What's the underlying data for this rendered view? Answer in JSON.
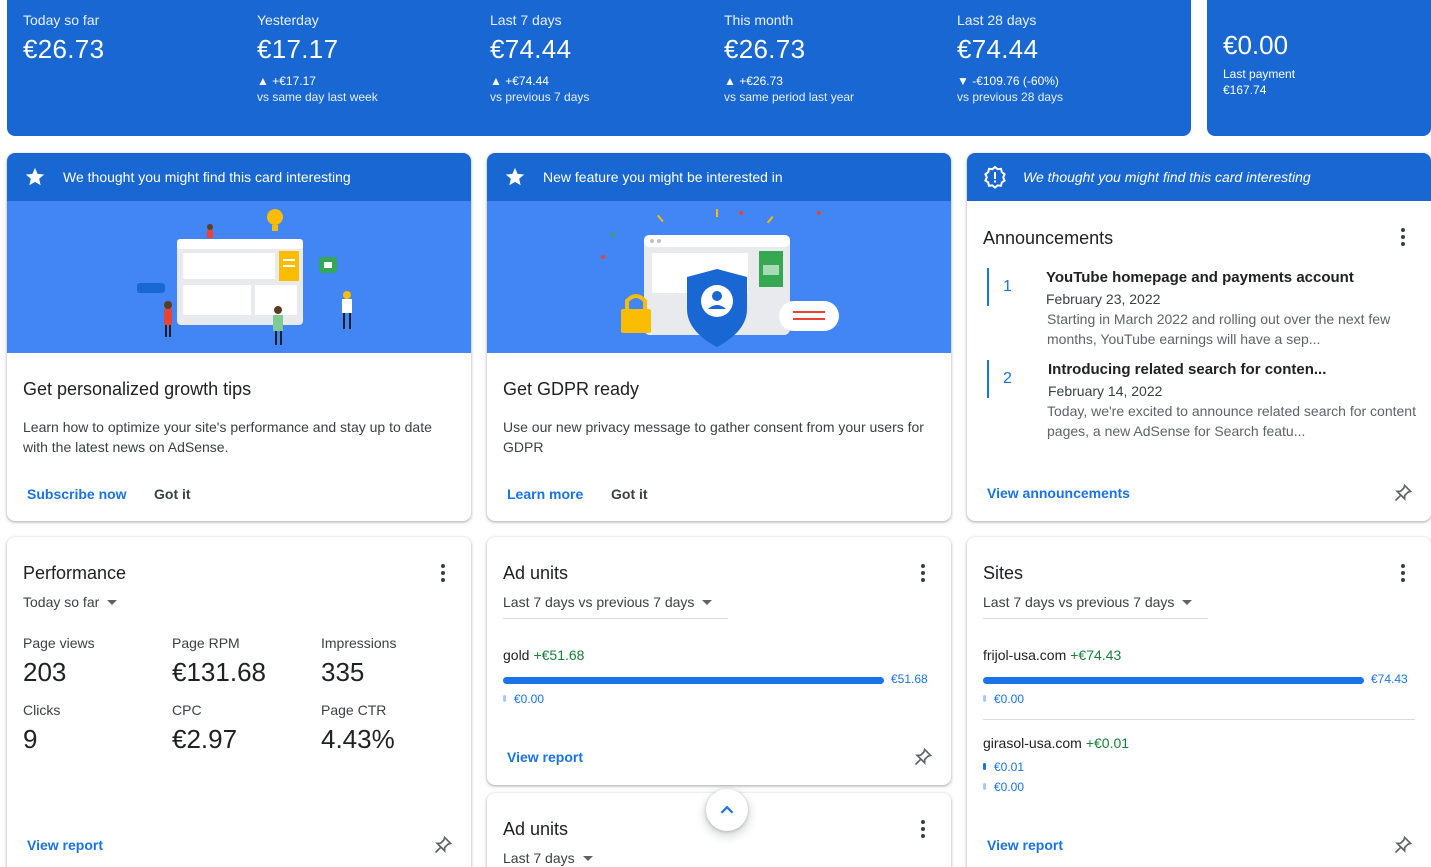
{
  "summary": {
    "stats": [
      {
        "label": "Today so far",
        "value": "€26.73",
        "change": "",
        "compare": ""
      },
      {
        "label": "Yesterday",
        "value": "€17.17",
        "change": "▲ +€17.17",
        "compare": "vs same day last week"
      },
      {
        "label": "Last 7 days",
        "value": "€74.44",
        "change": "▲ +€74.44",
        "compare": "vs previous 7 days"
      },
      {
        "label": "This month",
        "value": "€26.73",
        "change": "▲ +€26.73",
        "compare": "vs same period last year"
      },
      {
        "label": "Last 28 days",
        "value": "€74.44",
        "change": "▼ -€109.76 (-60%)",
        "compare": "vs previous 28 days"
      }
    ],
    "balance": {
      "value": "€0.00",
      "last_payment_label": "Last payment",
      "last_payment_value": "€167.74"
    }
  },
  "growth_card": {
    "header": "We thought you might find this card interesting",
    "title": "Get personalized growth tips",
    "body": "Learn how to optimize your site's performance and stay up to date with the latest news on AdSense.",
    "primary_action": "Subscribe now",
    "secondary_action": "Got it"
  },
  "gdpr_card": {
    "header": "New feature you might be interested in",
    "title": "Get GDPR ready",
    "body": "Use our new privacy message to gather consent from your users for GDPR",
    "primary_action": "Learn more",
    "secondary_action": "Got it"
  },
  "announcements_card": {
    "header": "We thought you might find this card interesting",
    "title": "Announcements",
    "items": [
      {
        "number": "1",
        "title": "YouTube homepage and payments account",
        "date": "February 23, 2022",
        "text": "Starting in March 2022 and rolling out over the next few months, YouTube earnings will have a sep..."
      },
      {
        "number": "2",
        "title": "Introducing related search for conten...",
        "date": "February 14, 2022",
        "text": "Today, we're excited to announce related search for content pages, a new AdSense for Search featu..."
      }
    ],
    "action": "View announcements"
  },
  "performance_card": {
    "title": "Performance",
    "range": "Today so far",
    "metrics": [
      {
        "label": "Page views",
        "value": "203"
      },
      {
        "label": "Page RPM",
        "value": "€131.68"
      },
      {
        "label": "Impressions",
        "value": "335"
      },
      {
        "label": "Clicks",
        "value": "9"
      },
      {
        "label": "CPC",
        "value": "€2.97"
      },
      {
        "label": "Page CTR",
        "value": "4.43%"
      }
    ],
    "action": "View report"
  },
  "ad_units_card": {
    "title": "Ad units",
    "range": "Last 7 days vs previous 7 days",
    "rows": [
      {
        "name": "gold",
        "change": "+€51.68",
        "current": "€51.68",
        "previous": "€0.00",
        "current_fraction": 1.0
      }
    ],
    "action": "View report"
  },
  "ad_units_card_2": {
    "title": "Ad units",
    "range": "Last 7 days"
  },
  "sites_card": {
    "title": "Sites",
    "range": "Last 7 days vs previous 7 days",
    "rows": [
      {
        "name": "frijol-usa.com",
        "change": "+€74.43",
        "current": "€74.43",
        "previous": "€0.00",
        "current_fraction": 1.0
      },
      {
        "name": "girasol-usa.com",
        "change": "+€0.01",
        "current": "€0.01",
        "previous": "€0.00",
        "current_fraction": 0.0
      }
    ],
    "action": "View report"
  },
  "colors": {
    "brand_blue": "#1967d2",
    "illustration_blue": "#4285f4",
    "link_blue": "#1a73e8",
    "positive_green": "#188038"
  },
  "icons": [
    "star-icon",
    "alert-badge-icon",
    "more-vert-icon",
    "pin-icon",
    "chevron-up-icon",
    "dropdown-caret-icon"
  ]
}
